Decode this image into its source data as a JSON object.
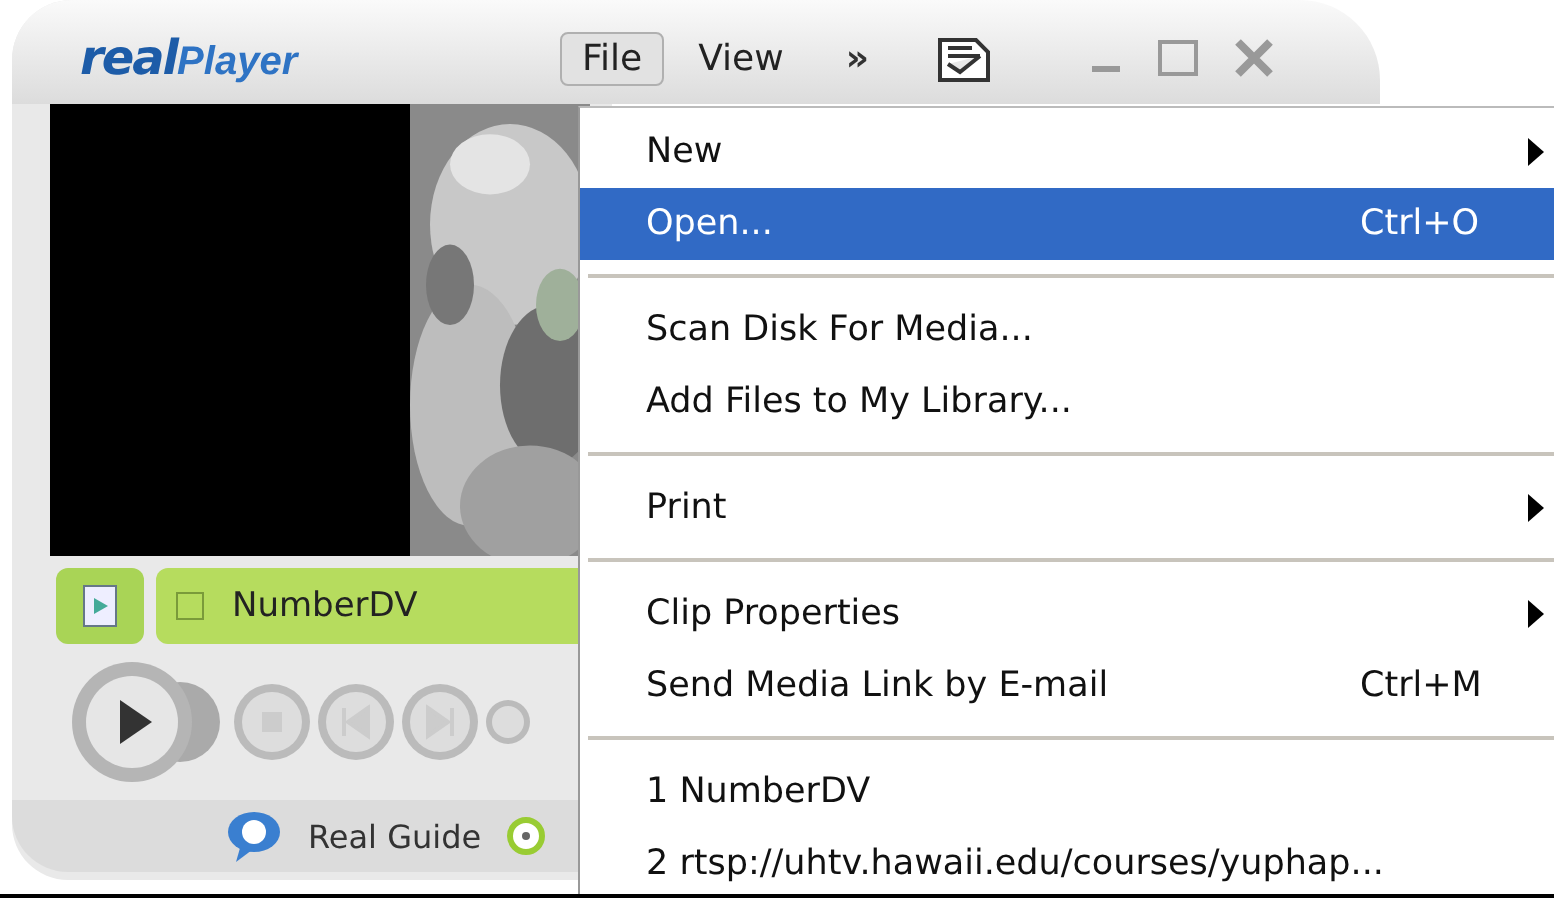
{
  "window": {
    "logo": {
      "part_1": "real",
      "part_2": "Player"
    },
    "menubar": [
      {
        "label": "File",
        "selected": true
      },
      {
        "label": "View",
        "selected": false
      }
    ],
    "more": "»"
  },
  "clip_bar": {
    "title": "NumberDV",
    "checked": false
  },
  "footer": {
    "guide": "Real Guide"
  },
  "menu": {
    "items": [
      {
        "kind": "item",
        "label": "New",
        "submenu": true,
        "selected": false
      },
      {
        "kind": "item",
        "label": "Open...",
        "shortcut": "Ctrl+O",
        "submenu": false,
        "selected": true
      },
      {
        "kind": "separator"
      },
      {
        "kind": "item",
        "label": "Scan Disk For Media...",
        "submenu": false,
        "selected": false
      },
      {
        "kind": "item",
        "label": "Add Files to My Library...",
        "submenu": false,
        "selected": false
      },
      {
        "kind": "separator"
      },
      {
        "kind": "item",
        "label": "Print",
        "submenu": true,
        "selected": false
      },
      {
        "kind": "separator"
      },
      {
        "kind": "item",
        "label": "Clip Properties",
        "submenu": true,
        "selected": false
      },
      {
        "kind": "item",
        "label": "Send Media Link by E-mail",
        "shortcut": "Ctrl+M",
        "submenu": false,
        "selected": false
      },
      {
        "kind": "separator"
      },
      {
        "kind": "item",
        "label": "1 NumberDV",
        "submenu": false,
        "selected": false
      },
      {
        "kind": "item",
        "label": "2 rtsp://uhtv.hawaii.edu/courses/yuphap...",
        "submenu": false,
        "selected": false
      }
    ]
  }
}
